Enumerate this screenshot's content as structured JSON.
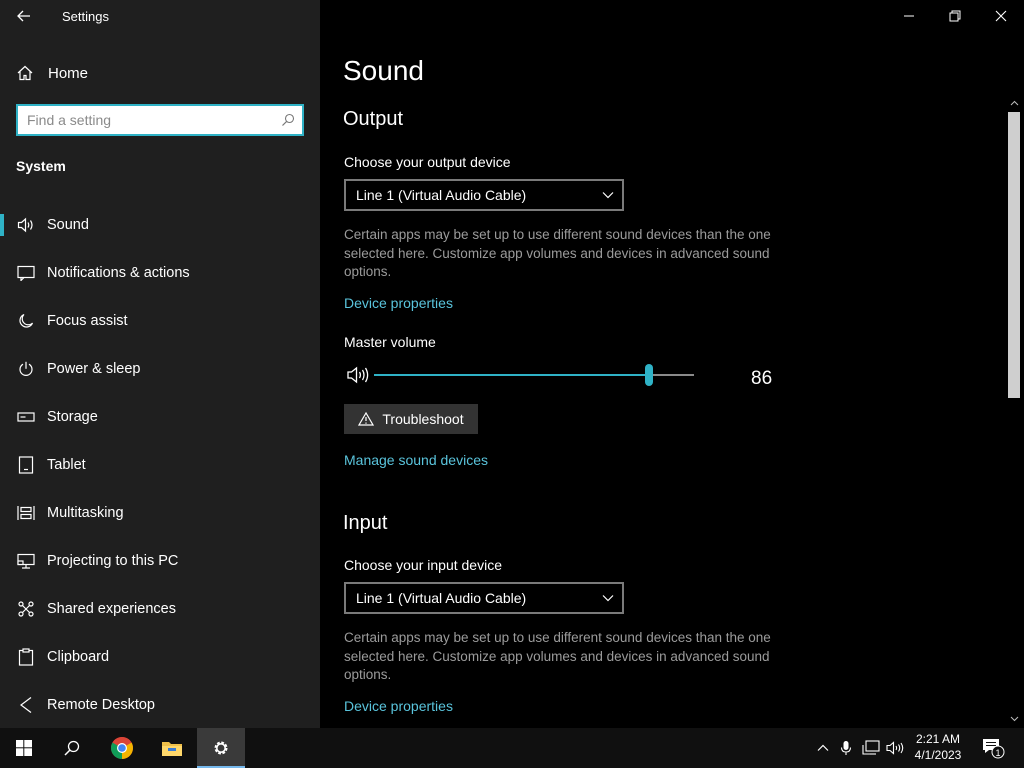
{
  "window": {
    "title": "Settings"
  },
  "sidebar": {
    "home_label": "Home",
    "search_placeholder": "Find a setting",
    "section": "System",
    "items": [
      {
        "label": "Sound",
        "icon": "speaker-icon",
        "selected": true
      },
      {
        "label": "Notifications & actions",
        "icon": "notification-icon"
      },
      {
        "label": "Focus assist",
        "icon": "moon-icon"
      },
      {
        "label": "Power & sleep",
        "icon": "power-icon"
      },
      {
        "label": "Storage",
        "icon": "storage-icon"
      },
      {
        "label": "Tablet",
        "icon": "tablet-icon"
      },
      {
        "label": "Multitasking",
        "icon": "multitasking-icon"
      },
      {
        "label": "Projecting to this PC",
        "icon": "projecting-icon"
      },
      {
        "label": "Shared experiences",
        "icon": "shared-experiences-icon"
      },
      {
        "label": "Clipboard",
        "icon": "clipboard-icon"
      },
      {
        "label": "Remote Desktop",
        "icon": "remote-desktop-icon"
      }
    ]
  },
  "main": {
    "title": "Sound",
    "output": {
      "heading": "Output",
      "device_label": "Choose your output device",
      "device_value": "Line 1 (Virtual Audio Cable)",
      "description": "Certain apps may be set up to use different sound devices than the one selected here. Customize app volumes and devices in advanced sound options.",
      "device_properties_link": "Device properties",
      "master_volume_label": "Master volume",
      "master_volume_value": "86",
      "volume_level_percent": 86,
      "troubleshoot_label": "Troubleshoot",
      "manage_link": "Manage sound devices"
    },
    "input": {
      "heading": "Input",
      "device_label": "Choose your input device",
      "device_value": "Line 1 (Virtual Audio Cable)",
      "description": "Certain apps may be set up to use different sound devices than the one selected here. Customize app volumes and devices in advanced sound options.",
      "device_properties_link": "Device properties"
    }
  },
  "taskbar": {
    "time": "2:21 AM",
    "date": "4/1/2023",
    "notification_count": "1"
  },
  "colors": {
    "accent": "#2fb2c6",
    "link": "#5ac4dc"
  }
}
